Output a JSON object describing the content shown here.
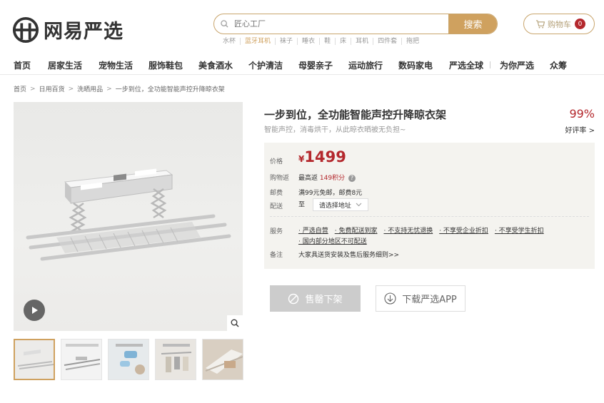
{
  "header": {
    "logo_text": "网易严选",
    "search": {
      "placeholder": "匠心工厂",
      "button": "搜索",
      "hot_words": [
        "水杯",
        "蓝牙耳机",
        "袜子",
        "睡衣",
        "鞋",
        "床",
        "耳机",
        "四件套",
        "拖把"
      ]
    },
    "cart": {
      "label": "购物车",
      "count": "0"
    }
  },
  "nav": [
    "首页",
    "居家生活",
    "宠物生活",
    "服饰鞋包",
    "美食酒水",
    "个护清洁",
    "母婴亲子",
    "运动旅行",
    "数码家电",
    "严选全球",
    "为你严选",
    "众筹"
  ],
  "breadcrumb": [
    "首页",
    "日用百货",
    "洗晒用品",
    "一步到位，全功能智能声控升降晾衣架"
  ],
  "product": {
    "title": "一步到位，全功能智能声控升降晾衣架",
    "subtitle": "智能声控，消毒烘干，从此晾衣晒被无负担~",
    "rate": "99%",
    "rate_label": "好评率 >",
    "price_label": "价格",
    "currency": "¥",
    "price": "1499",
    "points_label": "购物返",
    "points_prefix": "最高返",
    "points_value": "149积分",
    "shipping_label": "邮费",
    "shipping_text": "满99元免邮，邮费8元",
    "delivery_label": "配送",
    "delivery_to": "至",
    "delivery_select": "请选择地址",
    "service_label": "服务",
    "services": [
      "· 严选自营",
      "· 免费配送到家",
      "· 不支持无忧退换",
      "· 不享受企业折扣",
      "· 不享受学生折扣",
      "· 国内部分地区不可配送"
    ],
    "note_label": "备注",
    "note_text": "大家具送货安装及售后服务细则>>",
    "sold_out": "售罄下架",
    "download_app": "下载严选APP"
  },
  "colors": {
    "brand_gold": "#cfa15f",
    "price_red": "#b4282d"
  }
}
